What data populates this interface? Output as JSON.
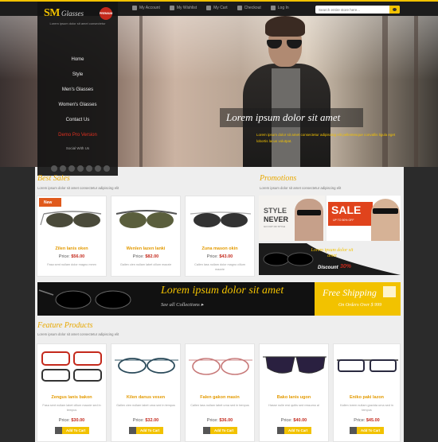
{
  "topbar": {
    "links": [
      "My Account",
      "My Wishlist",
      "My Cart",
      "Checkout",
      "Log In"
    ],
    "search_placeholder": "Search entire store here..."
  },
  "brand": {
    "logo_main": "SM",
    "logo_sub": "Glasses",
    "badge": "PREMIUM",
    "tagline": "Lorem ipsum dolor sit amet consectetur"
  },
  "menu": [
    "Home",
    "Style",
    "Men's Glasses",
    "Women's Glasses",
    "Contact Us",
    "Demo Pro Version"
  ],
  "social": {
    "label": "Social With Us"
  },
  "hero": {
    "title": "Lorem ipsum dolor sit amet",
    "subtitle": "Lorem ipsum dolor sit amet consectetur adipiscing elit pellentesque convallis ligula eget lobortis lacus volutpat."
  },
  "best_sales": {
    "title": "Best Sales",
    "subtitle": "Lorem ipsum dolor sit amet consectetur adipiscing elit",
    "badge": "New",
    "products": [
      {
        "name": "Zilen lanis oken",
        "price_label": "Price:",
        "price": "$56.00",
        "desc": "Fasa sent nullam dolor magno mmm"
      },
      {
        "name": "Wenlen lazen lanki",
        "price_label": "Price:",
        "price": "$82.00",
        "desc": "Gallen cien nullam labet cillum mazzie"
      },
      {
        "name": "Zuna mason okin",
        "price_label": "Price:",
        "price": "$43.00",
        "desc": "Callen lass nullam dolor magno cillum mazzie"
      }
    ]
  },
  "promotions": {
    "title": "Promotions",
    "subtitle": "Lorem ipsum dolor sit amet consectetur adipiscing elit",
    "style_line1": "STYLE",
    "style_line2": "NEVER",
    "style_line3": "GO OUT OF STYLE",
    "sale": "SALE",
    "sale_sub": "UP TO 50% OFF",
    "discount_title": "Lorem ipsum dolor sit amet",
    "discount_label": "Discount",
    "discount_value": "30%"
  },
  "banner": {
    "title": "Lorem ipsum dolor sit amet",
    "link": "See all Collections",
    "free_title": "Free Shipping",
    "free_sub": "On Orders Over $ 999"
  },
  "featured": {
    "title": "Feature Products",
    "subtitle": "Lorem ipsum dolor sit amet consectetur adipiscing elit",
    "add_to_cart": "Add To Cart",
    "products": [
      {
        "name": "Zengus lanis bakon",
        "price_label": "Price:",
        "price": "$30.00",
        "desc": "Fasa sent nullam labet cillum mazzie sed in tempus"
      },
      {
        "name": "Kilen danus vesen",
        "price_label": "Price:",
        "price": "$32.00",
        "desc": "Gallen cien nullam labet urna sed in tempus"
      },
      {
        "name": "Falen gakon masin",
        "price_label": "Price:",
        "price": "$36.00",
        "desc": "Callen lass nullam labet urna sed in tempus"
      },
      {
        "name": "Bako lanis ugon",
        "price_label": "Price:",
        "price": "$40.00",
        "desc": "Hasse nulle ersi quitis sed ressumo al"
      },
      {
        "name": "Eniko paki lazon",
        "price_label": "Price:",
        "price": "$45.00",
        "desc": "Kallen lorem nullam gravida urna sed in tempus"
      }
    ]
  },
  "colors": {
    "accent": "#f2c200",
    "price_red": "#c4291c",
    "name_orange": "#e39a00",
    "dark": "#1c1c1c"
  }
}
